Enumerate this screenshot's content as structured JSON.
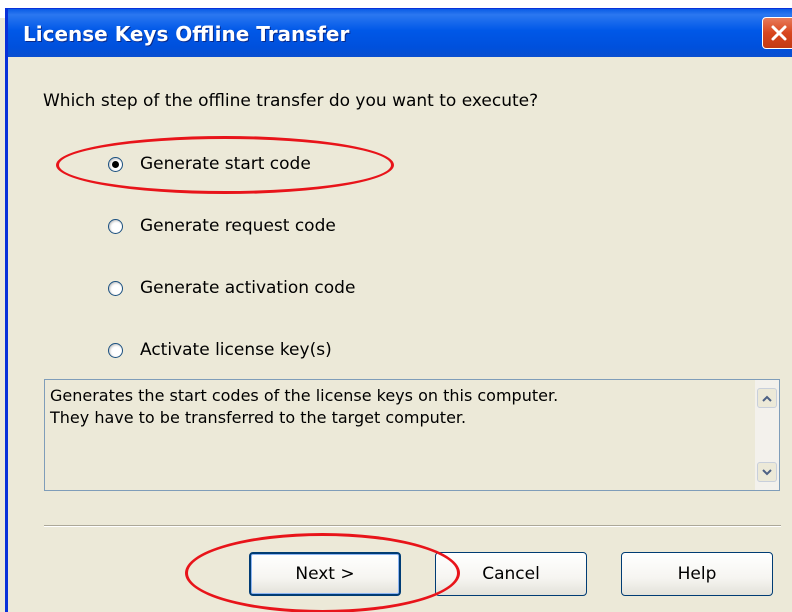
{
  "window": {
    "title": "License Keys Offline Transfer"
  },
  "question": "Which step of the offline transfer do you want to execute?",
  "options": [
    {
      "label": "Generate start code",
      "checked": true
    },
    {
      "label": "Generate request code",
      "checked": false
    },
    {
      "label": "Generate activation code",
      "checked": false
    },
    {
      "label": "Activate license key(s)",
      "checked": false
    }
  ],
  "description": {
    "line1": "Generates the start codes of the license keys on this computer.",
    "line2": "They have to be transferred to the target computer."
  },
  "buttons": {
    "next": "Next >",
    "cancel": "Cancel",
    "help": "Help"
  },
  "colors": {
    "titlebar": "#0058e8",
    "close_button": "#d8461e",
    "annotation": "#e8141a"
  },
  "icons": [
    "close-icon",
    "scroll-up-icon",
    "scroll-down-icon"
  ]
}
